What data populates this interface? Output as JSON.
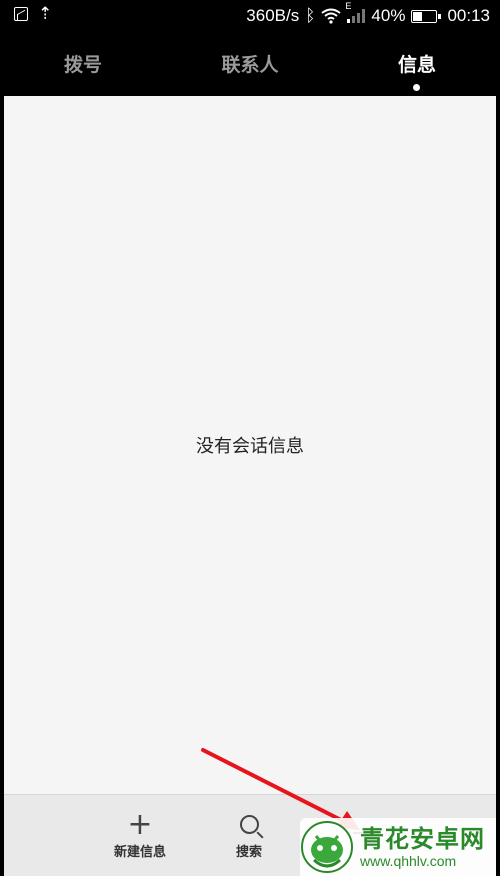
{
  "status_bar": {
    "speed": "360B/s",
    "network_type": "E",
    "battery_percent": "40%",
    "time": "00:13",
    "icons": [
      "gallery-icon",
      "upload-icon",
      "bluetooth-icon",
      "wifi-icon",
      "signal-icon",
      "battery-icon"
    ]
  },
  "tabs": [
    {
      "label": "拨号",
      "active": false
    },
    {
      "label": "联系人",
      "active": false
    },
    {
      "label": "信息",
      "active": true
    }
  ],
  "main": {
    "empty_message": "没有会话信息"
  },
  "bottom_bar": {
    "new_message_label": "新建信息",
    "search_label": "搜索"
  },
  "watermark": {
    "title": "青花安卓网",
    "url": "www.qhhlv.com"
  },
  "colors": {
    "annotation_arrow": "#e8141c",
    "watermark_green": "#2a8a2a"
  }
}
